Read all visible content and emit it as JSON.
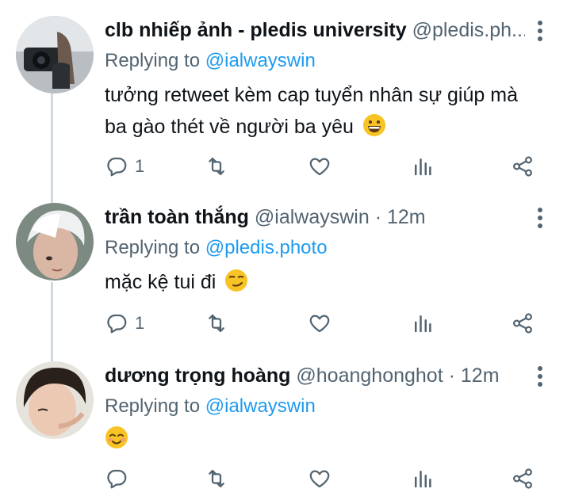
{
  "tweets": [
    {
      "name": "clb nhiếp ảnh - pledis university",
      "handle": "@pledis.ph...",
      "time": "",
      "replying_label": "Replying to",
      "replying_to": "@ialwayswin",
      "text_line1": "tưởng retweet kèm cap tuyển nhân sự giúp mà",
      "text_line2": "ba gào thét về người ba yêu",
      "emoji": "grinning-face",
      "reply_count": "1"
    },
    {
      "name": "trần toàn thắng",
      "handle": "@ialwayswin",
      "dot": "·",
      "time": "12m",
      "replying_label": "Replying to",
      "replying_to": "@pledis.photo",
      "text_line1": "mặc kệ tui đi",
      "emoji": "smirking-face",
      "reply_count": "1"
    },
    {
      "name": "dương trọng hoàng",
      "handle": "@hoanghonghot",
      "dot": "·",
      "time": "12m",
      "replying_label": "Replying to",
      "replying_to": "@ialwayswin",
      "text_line1": "",
      "emoji": "smiling-face",
      "reply_count": ""
    }
  ],
  "colors": {
    "text": "#0f1419",
    "secondary": "#536471",
    "accent": "#1d9bf0",
    "thread_line": "#cfd9de"
  },
  "icons": [
    "reply-icon",
    "retweet-icon",
    "like-icon",
    "analytics-icon",
    "share-icon",
    "more-icon"
  ]
}
